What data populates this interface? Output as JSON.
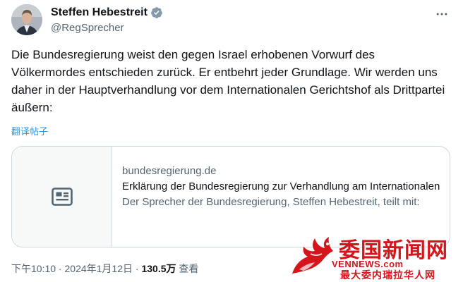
{
  "author": {
    "display_name": "Steffen Hebestreit",
    "handle": "@RegSprecher",
    "verified_color": "#829aab",
    "avatar": "profile-photo"
  },
  "more_icon": "more-horizontal-icon",
  "tweet": {
    "text": "Die Bundesregierung weist den gegen Israel erhobenen Vorwurf des Völkermordes entschieden zurück. Er entbehrt jeder Grundlage. Wir werden uns daher in der Hauptverhandlung vor dem Internationalen Gerichtshof als Drittpartei äußern:",
    "translate_label": "翻译帖子"
  },
  "card": {
    "thumb_icon": "article-icon",
    "domain": "bundesregierung.de",
    "title": "Erklärung der Bundesregierung zur Verhandlung am Internationalen Gerichtshof",
    "description": "Der Sprecher der Bundesregierung, Steffen Hebestreit, teilt mit:"
  },
  "meta": {
    "time": "下午10:10",
    "separator": " · ",
    "date": "2024年1月12日",
    "views_count": "130.5万",
    "views_label": "查看"
  },
  "watermark": {
    "title": "委国新闻网",
    "domain": "VENNEWS.com",
    "subtitle": "最大委内瑞拉华人网",
    "color": "#d4161c"
  },
  "colors": {
    "text": "#0f1419",
    "secondary": "#536471",
    "link": "#1d9bf0",
    "border": "#cfd9de"
  }
}
